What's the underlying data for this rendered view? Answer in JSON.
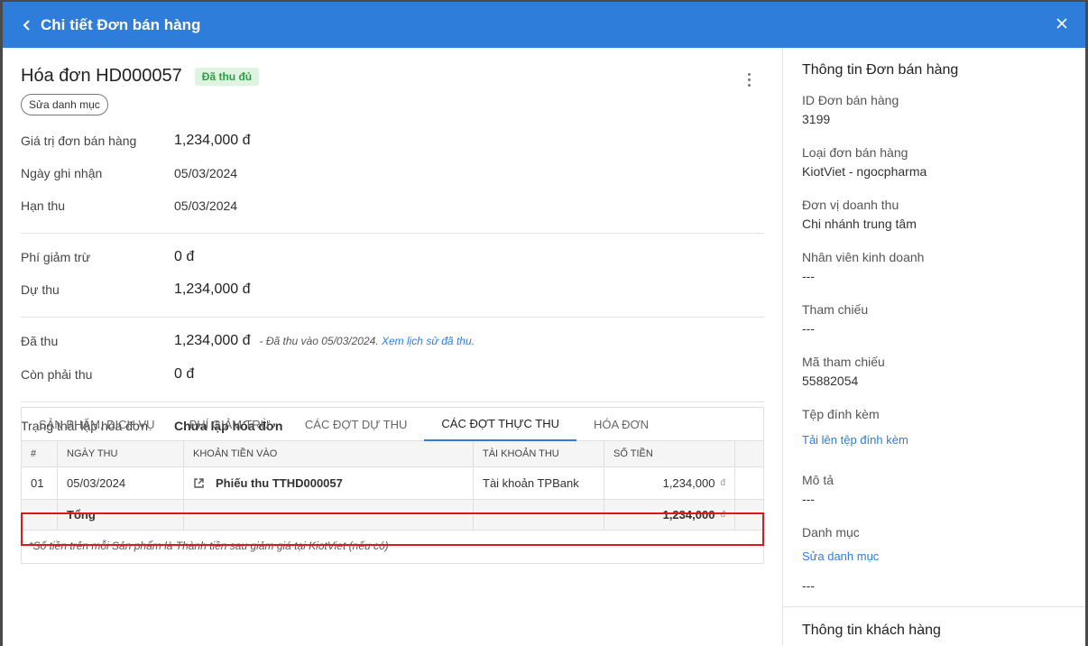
{
  "header": {
    "title": "Chi tiết Đơn bán hàng"
  },
  "invoice": {
    "title": "Hóa đơn HD000057",
    "status": "Đã thu đủ",
    "edit_category": "Sửa danh mục"
  },
  "fields": {
    "order_value": {
      "label": "Giá trị đơn bán hàng",
      "value": "1,234,000 đ"
    },
    "record_date": {
      "label": "Ngày ghi nhận",
      "value": "05/03/2024"
    },
    "due_date": {
      "label": "Hạn thu",
      "value": "05/03/2024"
    },
    "deduction": {
      "label": "Phí giảm trừ",
      "value": "0 đ"
    },
    "expected": {
      "label": "Dự thu",
      "value": "1,234,000 đ"
    },
    "collected": {
      "label": "Đã thu",
      "value": "1,234,000 đ",
      "note": "- Đã thu vào 05/03/2024.",
      "link": "Xem lịch sử đã thu."
    },
    "remaining": {
      "label": "Còn phải thu",
      "value": "0 đ"
    },
    "invoice_status": {
      "label": "Trạng thái lập hóa đơn",
      "value": "Chưa lập hóa đơn"
    }
  },
  "tabs": [
    "SẢN PHẨM, DỊCH VỤ",
    "PHÍ GIẢM TRỪ",
    "CÁC ĐỢT DỰ THU",
    "CÁC ĐỢT THỰC THU",
    "HÓA ĐƠN"
  ],
  "table": {
    "headers": [
      "#",
      "NGÀY THU",
      "KHOẢN TIỀN VÀO",
      "TÀI KHOẢN THU",
      "SỐ TIỀN"
    ],
    "row": {
      "index": "01",
      "date": "05/03/2024",
      "receipt": "Phiếu thu TTHD000057",
      "account": "Tài khoản TPBank",
      "amount": "1,234,000",
      "currency": "đ"
    },
    "total": {
      "label": "Tổng",
      "amount": "1,234,000",
      "currency": "đ"
    },
    "footnote": "*Số tiền trên mỗi Sản phẩm là Thành tiền sau giảm giá tại KiotViet (nếu có)"
  },
  "sidebar": {
    "title": "Thông tin Đơn bán hàng",
    "items": [
      {
        "label": "ID Đơn bán hàng",
        "value": "3199"
      },
      {
        "label": "Loại đơn bán hàng",
        "value": "KiotViet - ngocpharma"
      },
      {
        "label": "Đơn vị doanh thu",
        "value": "Chi nhánh trung tâm"
      },
      {
        "label": "Nhân viên kinh doanh",
        "value": "---"
      },
      {
        "label": "Tham chiếu",
        "value": "---"
      },
      {
        "label": "Mã tham chiếu",
        "value": "55882054"
      }
    ],
    "attachment": {
      "label": "Tệp đính kèm",
      "link": "Tải lên tệp đính kèm"
    },
    "description": {
      "label": "Mô tả",
      "value": "---"
    },
    "category": {
      "label": "Danh mục",
      "link": "Sửa danh mục",
      "value": "---"
    },
    "customer_title": "Thông tin khách hàng"
  },
  "colors": {
    "header": "#2e7ddb",
    "status_bg": "#dff3e1",
    "status_text": "#2e9e45",
    "highlight": "#e3161c"
  }
}
